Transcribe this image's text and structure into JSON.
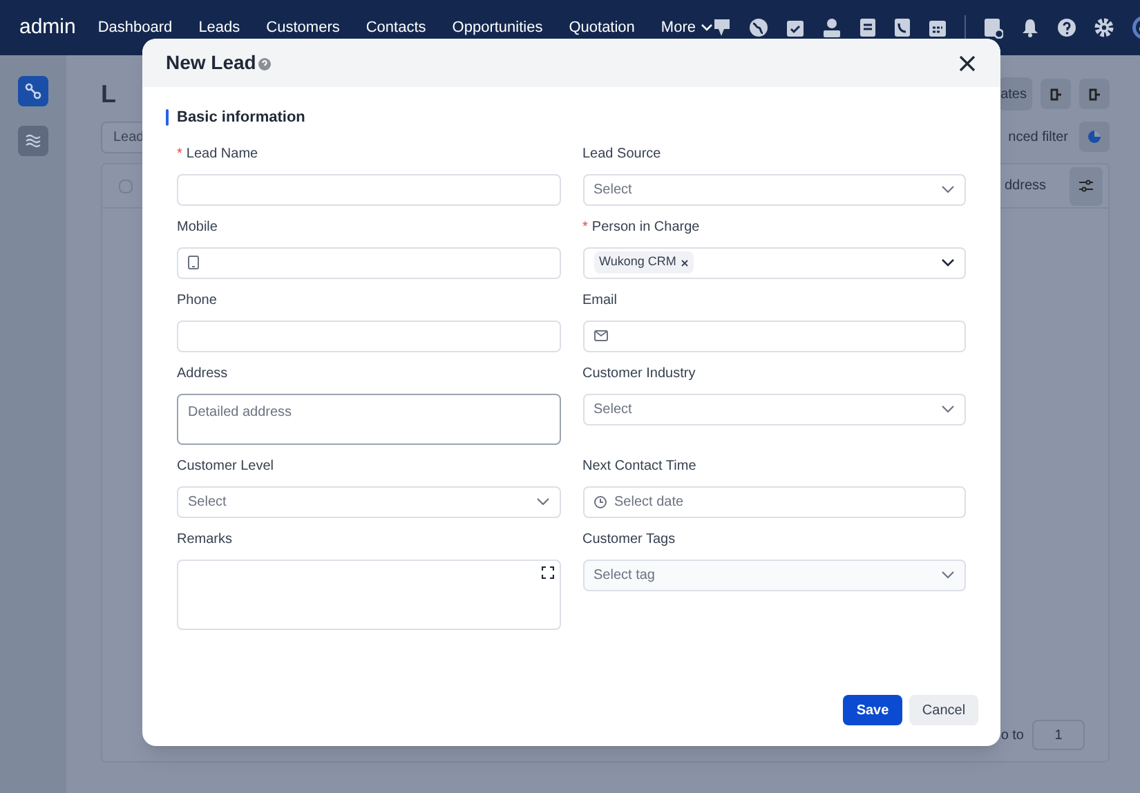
{
  "navbar": {
    "brand": "admin",
    "menu": [
      {
        "label": "Dashboard",
        "kind": "link"
      },
      {
        "label": "Leads",
        "kind": "link"
      },
      {
        "label": "Customers",
        "kind": "link"
      },
      {
        "label": "Contacts",
        "kind": "link"
      },
      {
        "label": "Opportunities",
        "kind": "link"
      },
      {
        "label": "Quotation",
        "kind": "link"
      },
      {
        "label": "More",
        "kind": "dropdown"
      }
    ]
  },
  "background": {
    "title": "L",
    "checked": false,
    "search_placeholder": "Lead",
    "buttons": [
      "ates",
      "nced filter"
    ],
    "column_header": "ddress",
    "goto_label": "o to",
    "goto_value": "1"
  },
  "dialog": {
    "title": "New Lead",
    "section": "Basic information",
    "required_mark": "*",
    "fields": [
      {
        "label": "Lead Name",
        "required": true,
        "kind": "text"
      },
      {
        "label": "Lead Source",
        "required": false,
        "kind": "select",
        "placeholder": "Select"
      },
      {
        "label": "Mobile",
        "required": false,
        "kind": "mobile"
      },
      {
        "label": "Person in Charge",
        "required": true,
        "kind": "user-select",
        "tags": [
          "Wukong CRM"
        ]
      },
      {
        "label": "Phone",
        "required": false,
        "kind": "text"
      },
      {
        "label": "Email",
        "required": false,
        "kind": "email"
      },
      {
        "label": "Address",
        "required": false,
        "kind": "textarea",
        "placeholder": "Detailed address"
      },
      {
        "label": "Customer Industry",
        "required": false,
        "kind": "select",
        "placeholder": "Select"
      },
      {
        "label": "Customer Level",
        "required": false,
        "kind": "select",
        "placeholder": "Select"
      },
      {
        "label": "Next Contact Time",
        "required": false,
        "kind": "date",
        "placeholder": "Select date"
      },
      {
        "label": "Remarks",
        "required": false,
        "kind": "rich-text"
      },
      {
        "label": "Customer Tags",
        "required": false,
        "kind": "tag-select",
        "placeholder": "Select tag"
      }
    ],
    "buttons": [
      {
        "label": "Save",
        "kind": "primary"
      },
      {
        "label": "Cancel",
        "kind": "secondary"
      }
    ]
  }
}
